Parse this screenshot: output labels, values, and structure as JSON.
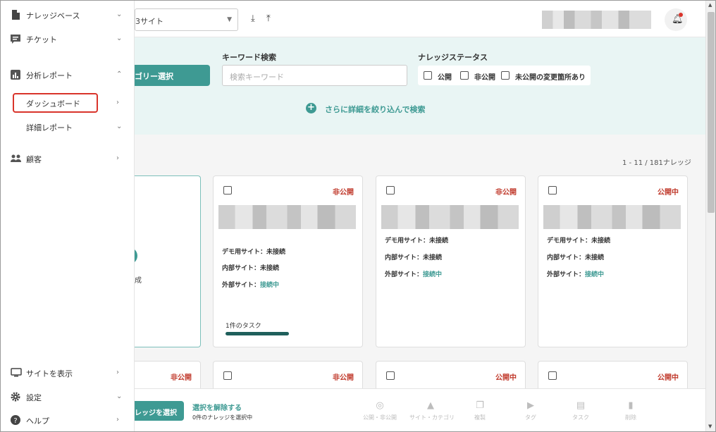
{
  "sidebar": {
    "items": [
      {
        "label": "ナレッジベース",
        "icon": "document-icon",
        "chevron": "⌄"
      },
      {
        "label": "チケット",
        "icon": "ticket-icon",
        "chevron": "⌄"
      },
      {
        "label": "分析レポート",
        "icon": "chart-icon",
        "chevron": "⌃"
      },
      {
        "label": "ダッシュボード",
        "chevron": "›"
      },
      {
        "label": "詳細レポート",
        "chevron": "⌄"
      },
      {
        "label": "顧客",
        "icon": "people-icon",
        "chevron": "›"
      },
      {
        "label": "サイトを表示",
        "icon": "monitor-icon",
        "chevron": "›"
      },
      {
        "label": "設定",
        "icon": "gear-icon",
        "chevron": "⌄"
      },
      {
        "label": "ヘルプ",
        "icon": "help-icon",
        "chevron": "›"
      }
    ]
  },
  "topbar": {
    "site_select": "3サイト",
    "download_icon": "⤓",
    "upload_icon": "⤒"
  },
  "filter": {
    "category_button": "ゴリー選択",
    "keyword_label": "キーワード検索",
    "keyword_placeholder": "検索キーワード",
    "status_label": "ナレッジステータス",
    "status_options": [
      "公開",
      "非公開",
      "未公開の変更箇所あり"
    ],
    "more_filter": "さらに詳細を絞り込んで検索"
  },
  "content": {
    "count": "1 - 11 / 181ナレッジ",
    "new_card_text": "成",
    "cards": [
      {
        "status": "非公開",
        "demo": "デモ用サイト：未接続",
        "internal": "内部サイト：未接続",
        "external_prefix": "外部サイト：",
        "external_state": "接続中",
        "task": "1件のタスク"
      },
      {
        "status": "非公開",
        "demo": "デモ用サイト：未接続",
        "internal": "内部サイト：未接続",
        "external_prefix": "外部サイト：",
        "external_state": "接続中"
      },
      {
        "status": "公開中",
        "demo": "デモ用サイト：未接続",
        "internal": "内部サイト：未接続",
        "external_prefix": "外部サイト：",
        "external_state": "接続中"
      }
    ],
    "row2": [
      "非公開",
      "非公開",
      "公開中",
      "公開中"
    ]
  },
  "bottombar": {
    "select_button": "レッジを選択",
    "unselect": "選択を解除する",
    "selected_count": "0件のナレッジを選択中",
    "actions": [
      {
        "icon": "globe-icon",
        "label": "公開・非公開"
      },
      {
        "icon": "shapes-icon",
        "label": "サイト・カテゴリ"
      },
      {
        "icon": "copy-icon",
        "label": "複製"
      },
      {
        "icon": "tag-icon",
        "label": "タグ"
      },
      {
        "icon": "task-icon",
        "label": "タスク"
      },
      {
        "icon": "trash-icon",
        "label": "削除"
      }
    ]
  },
  "colors": {
    "accent": "#3e9a93",
    "private": "#c0392b",
    "highlight": "#d9342b"
  }
}
